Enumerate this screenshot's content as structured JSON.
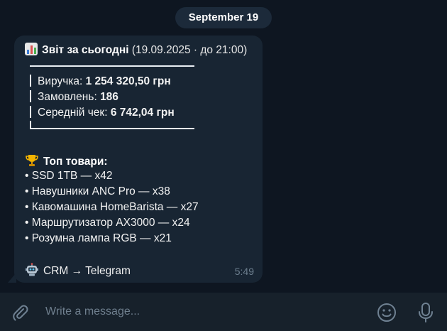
{
  "chat": {
    "date_label": "September 19"
  },
  "message": {
    "header_title": "Звіт за сьогодні",
    "header_meta": "(19.09.2025 · до 21:00)",
    "stats": [
      {
        "label": "Виручка: ",
        "value": "1 254 320,50 грн"
      },
      {
        "label": "Замовлень: ",
        "value": "186"
      },
      {
        "label": "Середній чек: ",
        "value": "6 742,04 грн"
      }
    ],
    "top_title": "Топ товари:",
    "top_items": [
      "• SSD 1TB — x42",
      "• Навушники ANC Pro — x38",
      "• Кавомашина HomeBarista — x27",
      "• Маршрутизатор AX3000 — x24",
      "• Розумна лампа RGB — x21"
    ],
    "footer_text": "CRM → Telegram",
    "time": "5:49"
  },
  "composer": {
    "placeholder": "Write a message..."
  },
  "icons": {
    "chart": "bar-chart-icon",
    "trophy": "trophy-icon",
    "robot": "robot-icon",
    "attach": "paperclip-icon",
    "emoji": "smiley-icon",
    "mic": "microphone-icon"
  },
  "colors": {
    "background": "#0e1621",
    "bubble": "#182533",
    "composer": "#17212b",
    "muted": "#6d7f8f"
  }
}
